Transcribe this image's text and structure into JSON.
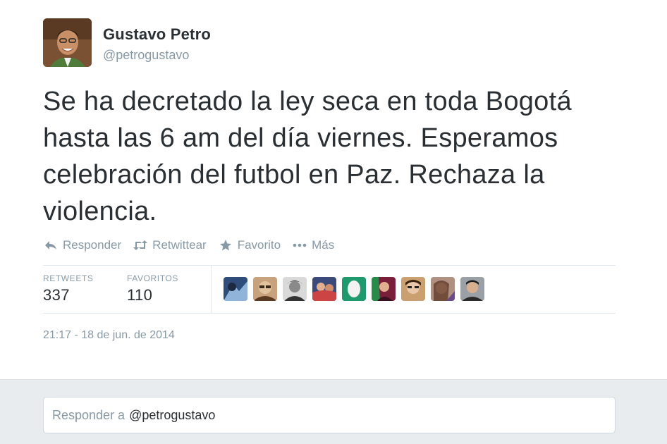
{
  "author": {
    "name": "Gustavo Petro",
    "handle": "@petrogustavo"
  },
  "tweet": {
    "text": "Se ha decretado la ley seca en toda Bogotá hasta las 6 am del día viernes. Esperamos celebración del futbol en Paz. Rechaza la violencia.",
    "timestamp": "21:17 - 18 de jun. de 2014"
  },
  "actions": [
    {
      "label": "Responder",
      "icon": "reply-icon"
    },
    {
      "label": "Retwittear",
      "icon": "retweet-icon"
    },
    {
      "label": "Favorito",
      "icon": "star-icon"
    },
    {
      "label": "Más",
      "icon": "more-dots-icon"
    }
  ],
  "stats": {
    "retweets_label": "RETWEETS",
    "retweets_value": "337",
    "favorites_label": "FAVORITOS",
    "favorites_value": "110"
  },
  "favoriters_count_shown": 9,
  "reply": {
    "prefix": "Responder a",
    "handle": "@petrogustavo"
  },
  "colors": {
    "text": "#292f33",
    "muted": "#8899a6",
    "divider": "#e1e8ed",
    "reply_bg": "#e9ecef"
  }
}
